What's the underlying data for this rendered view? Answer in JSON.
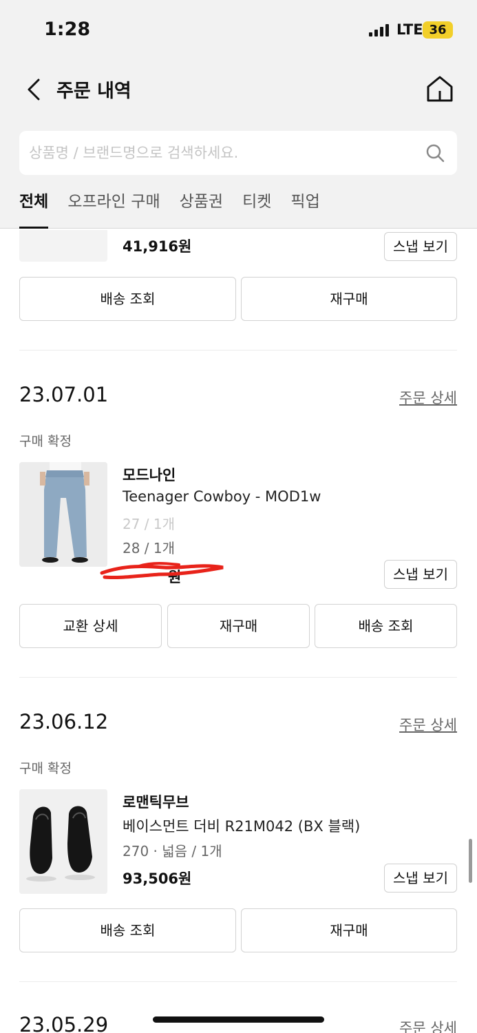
{
  "status_bar": {
    "time": "1:28",
    "network": "LTE",
    "battery": "36"
  },
  "header": {
    "title": "주문 내역"
  },
  "search": {
    "placeholder": "상품명 / 브랜드명으로 검색하세요."
  },
  "tabs": [
    {
      "label": "전체",
      "active": true
    },
    {
      "label": "오프라인 구매",
      "active": false
    },
    {
      "label": "상품권",
      "active": false
    },
    {
      "label": "티켓",
      "active": false
    },
    {
      "label": "픽업",
      "active": false
    }
  ],
  "partial_order": {
    "price": "41,916원",
    "snap_label": "스냅 보기",
    "actions": [
      "배송 조회",
      "재구매"
    ]
  },
  "orders": [
    {
      "date": "23.07.01",
      "detail_label": "주문 상세",
      "status": "구매 확정",
      "brand": "모드나인",
      "product": "Teenager Cowboy - MOD1w",
      "option_faded": "27 / 1개",
      "option": "28 / 1개",
      "price_redacted_suffix": "원",
      "snap_label": "스냅 보기",
      "actions": [
        "교환 상세",
        "재구매",
        "배송 조회"
      ]
    },
    {
      "date": "23.06.12",
      "detail_label": "주문 상세",
      "status": "구매 확정",
      "brand": "로맨틱무브",
      "product": "베이스먼트 더비 R21M042 (BX 블랙)",
      "option": "270 · 넓음 / 1개",
      "price": "93,506원",
      "snap_label": "스냅 보기",
      "actions": [
        "배송 조회",
        "재구매"
      ]
    },
    {
      "date": "23.05.29",
      "detail_label": "주문 상세"
    }
  ],
  "colors": {
    "accent_underline": "#111111",
    "battery": "#f2cf2a",
    "redaction": "#e8231a"
  }
}
